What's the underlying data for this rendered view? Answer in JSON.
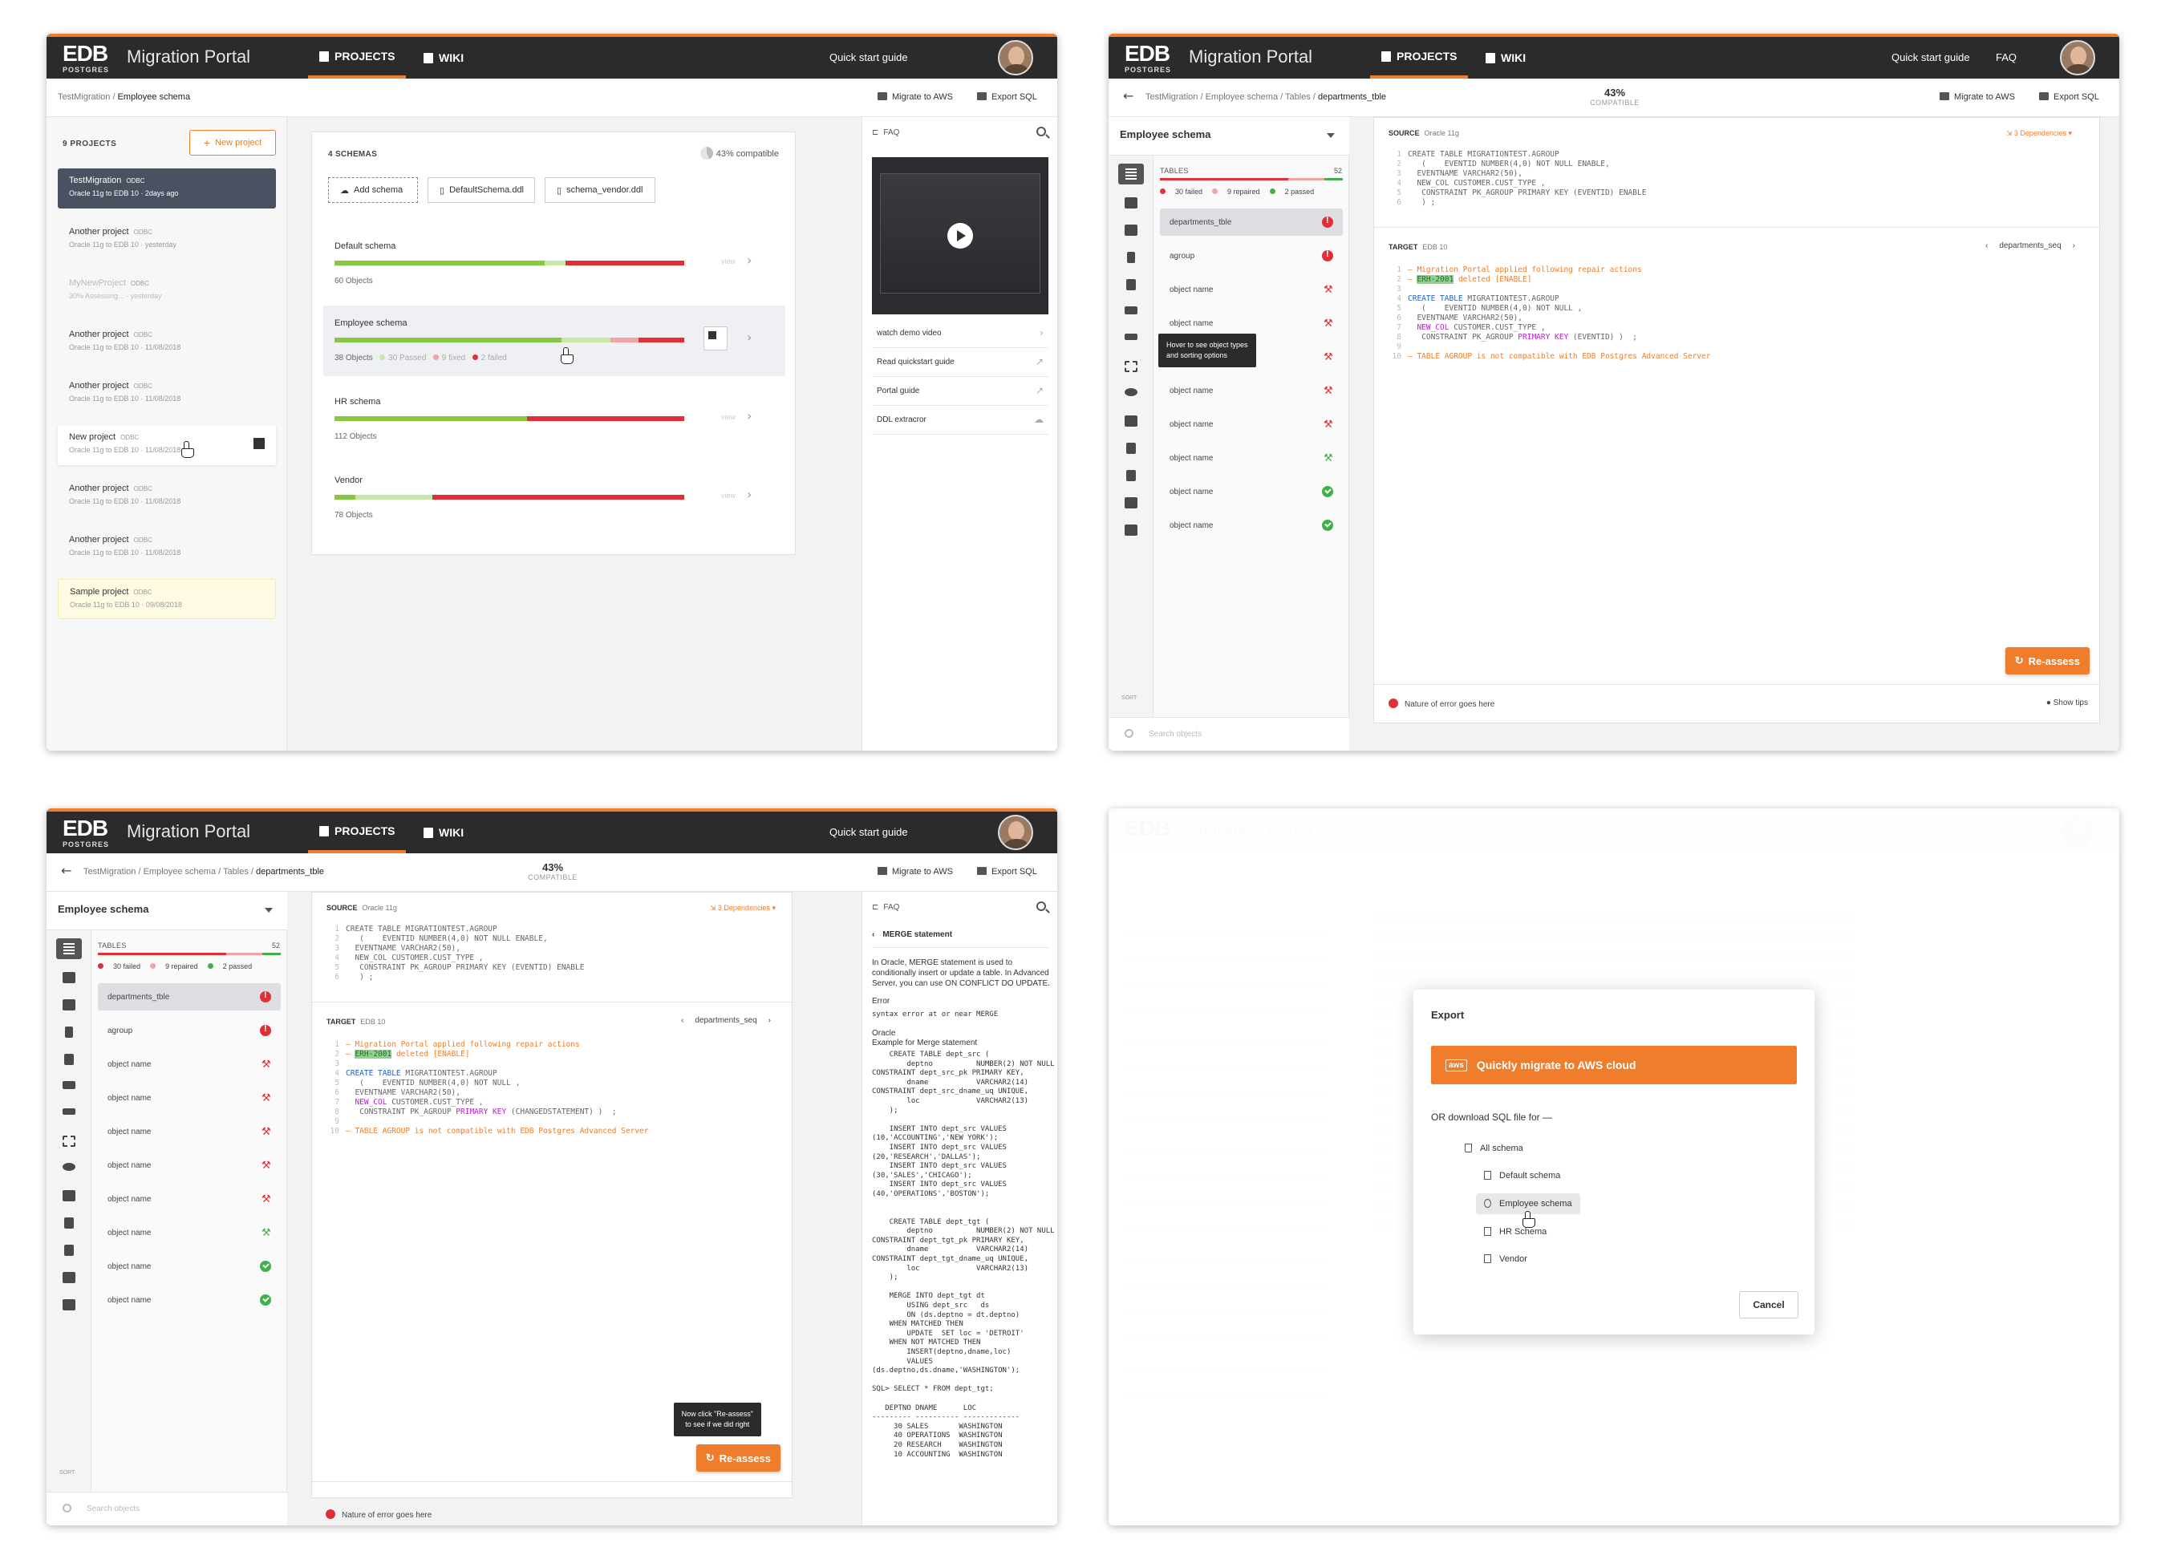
{
  "header": {
    "logo_main": "EDB",
    "logo_sub": "POSTGRES",
    "app_title": "Migration Portal",
    "nav_projects": "PROJECTS",
    "nav_wiki": "WIKI",
    "quick_start": "Quick start guide",
    "faq": "FAQ"
  },
  "toolbar": {
    "migrate_aws": "Migrate to AWS",
    "export_sql": "Export SQL",
    "compat_value": "43%",
    "compat_label": "COMPATIBLE"
  },
  "screen1": {
    "crumb_root": "TestMigration / ",
    "crumb_current": "Employee schema",
    "projects_count": "9 PROJECTS",
    "new_project": "New project",
    "projects": [
      {
        "name": "TestMigration",
        "tag": "ODBC",
        "sub": "Oracle 11g to EDB 10  ·  2days ago"
      },
      {
        "name": "Another project",
        "tag": "ODBC",
        "sub": "Oracle 11g to EDB 10  ·  yesterday"
      },
      {
        "name": "MyNewProject",
        "tag": "ODBC",
        "sub": "30% Assessing...  ·  yesterday"
      },
      {
        "name": "Another project",
        "tag": "ODBC",
        "sub": "Oracle 11g to EDB 10  ·  11/08/2018"
      },
      {
        "name": "Another project",
        "tag": "ODBC",
        "sub": "Oracle 11g to EDB 10  ·  11/08/2018"
      },
      {
        "name": "New project",
        "tag": "ODBC",
        "sub": "Oracle 11g to EDB 10  ·  11/08/2018"
      },
      {
        "name": "Another project",
        "tag": "ODBC",
        "sub": "Oracle 11g to EDB 10  ·  11/08/2018"
      },
      {
        "name": "Another project",
        "tag": "ODBC",
        "sub": "Oracle 11g to EDB 10  ·  11/08/2018"
      },
      {
        "name": "Sample project",
        "tag": "ODBC",
        "sub": "Oracle 11g to EDB 10  ·  09/08/2018"
      }
    ],
    "schemas_count": "4 SCHEMAS",
    "schemas_compat": "43% compatible",
    "add_schema": "Add schema",
    "file1": "DefaultSchema.ddl",
    "file2": "schema_vendor.ddl",
    "schemas": [
      {
        "name": "Default schema",
        "objects": "60  Objects",
        "green": 0.6,
        "light": 0.06,
        "red": 0.34
      },
      {
        "name": "Employee schema",
        "objects": "38  Objects",
        "passed": "30 Passed",
        "repaired": "9 fixed",
        "failed": "2 failed",
        "green": 0.65,
        "light": 0.14,
        "pink": 0.08,
        "red": 0.13
      },
      {
        "name": "HR schema",
        "objects": "112  Objects",
        "green": 0.55,
        "light": 0.0,
        "red": 0.45
      },
      {
        "name": "Vendor",
        "objects": "78  Objects",
        "green": 0.06,
        "light": 0.22,
        "red": 0.72
      }
    ],
    "view": "view",
    "faq_title": "FAQ",
    "faq_links": [
      "watch demo video",
      "Read quickstart guide",
      "Portal guide",
      "DDL extracror"
    ]
  },
  "detail": {
    "crumb_root": "TestMigration / Employee schema / Tables / ",
    "crumb_current": "departments_tble",
    "schema_select": "Employee schema",
    "tables_label": "TABLES",
    "tables_count": "52",
    "failed": "30 failed",
    "repaired": "9 repaired",
    "passed": "2 passed",
    "rows": [
      {
        "name": "departments_tble",
        "status": "fail"
      },
      {
        "name": "agroup",
        "status": "fail"
      },
      {
        "name": "object name",
        "status": "rep"
      },
      {
        "name": "object name",
        "status": "rep"
      },
      {
        "name": "object name",
        "status": "rep"
      },
      {
        "name": "object name",
        "status": "rep"
      },
      {
        "name": "object name",
        "status": "rep"
      },
      {
        "name": "object name",
        "status": "repg"
      },
      {
        "name": "object name",
        "status": "ok"
      },
      {
        "name": "object name",
        "status": "ok"
      }
    ],
    "search_placeholder": "Search objects",
    "sort": "SORT",
    "source_label": "SOURCE",
    "source_db": "Oracle 11g",
    "dependencies": "3 Dependencies",
    "source_code": [
      "CREATE TABLE MIGRATIONTEST.AGROUP",
      "   (    EVENTID NUMBER(4,0) NOT NULL ENABLE,",
      "  EVENTNAME VARCHAR2(50),",
      "  NEW_COL CUSTOMER.CUST_TYPE ,",
      "   CONSTRAINT PK_AGROUP PRIMARY KEY (EVENTID) ENABLE",
      "   ) ;"
    ],
    "target_label": "TARGET",
    "target_db": "EDB 10",
    "seq": "departments_seq",
    "target_c1": "— Migration Portal applied following repair actions",
    "target_c2a": "— ",
    "target_c2b": "ERH-2001",
    "target_c2c": " deleted [ENABLE]",
    "target_code_head": "CREATE TABLE",
    "target_code_tbl": " MIGRATIONTEST.AGROUP",
    "target_l4": "   (    EVENTID NUMBER(4,0) NOT NULL ,",
    "target_l5": "  EVENTNAME VARCHAR2(50),",
    "target_l6a": "  NEW_COL",
    "target_l6b": " CUSTOMER.CUST_TYPE ,",
    "target_l7a": "   CONSTRAINT PK_AGROUP ",
    "target_l7b": "PRIMARY KEY",
    "target_l7c_p2": " (EVENTID) )  ;",
    "target_l7c_p3": " (CHANGEDSTATEMENT) )  ;",
    "target_err": "— TABLE AGROUP is not compatible with EDB Postgres Advanced Server",
    "reassess": "Re-assess",
    "error_text": "Nature of error goes here",
    "show_tips": "Show tips",
    "tooltip_hover_1": "Hover to see object types",
    "tooltip_hover_2": "and sorting options",
    "tooltip_re_1": "Now click \"Re-assess\"",
    "tooltip_re_2": "to see if we did right"
  },
  "faq3": {
    "title": "FAQ",
    "topic": "MERGE statement",
    "intro": "In Oracle, MERGE statement is used to conditionally insert or update a table. In Advanced Server, you can use ON CONFLICT DO UPDATE.",
    "error_label": "Error",
    "error_text": "syntax error at or near MERGE",
    "oracle_label": "Oracle",
    "example_label": "Example for Merge statement",
    "code": [
      "    CREATE TABLE dept_src (",
      "        deptno          NUMBER(2) NOT NULL",
      "CONSTRAINT dept_src_pk PRIMARY KEY,",
      "        dname           VARCHAR2(14)",
      "CONSTRAINT dept_src_dname_uq UNIQUE,",
      "        loc             VARCHAR2(13)",
      "    );",
      "",
      "    INSERT INTO dept_src VALUES",
      "(10,'ACCOUNTING','NEW YORK');",
      "    INSERT INTO dept_src VALUES",
      "(20,'RESEARCH','DALLAS');",
      "    INSERT INTO dept_src VALUES",
      "(30,'SALES','CHICAGO');",
      "    INSERT INTO dept_src VALUES",
      "(40,'OPERATIONS','BOSTON');",
      "",
      "",
      "    CREATE TABLE dept_tgt (",
      "        deptno          NUMBER(2) NOT NULL",
      "CONSTRAINT dept_tgt_pk PRIMARY KEY,",
      "        dname           VARCHAR2(14)",
      "CONSTRAINT dept_tgt_dname_uq UNIQUE,",
      "        loc             VARCHAR2(13)",
      "    );",
      "",
      "    MERGE INTO dept_tgt dt",
      "        USING dept_src   ds",
      "        ON (ds.deptno = dt.deptno)",
      "    WHEN MATCHED THEN",
      "        UPDATE  SET loc = 'DETROIT'",
      "    WHEN NOT MATCHED THEN",
      "        INSERT(deptno,dname,loc)",
      "        VALUES",
      "(ds.deptno,ds.dname,'WASHINGTON');",
      "",
      "SQL> SELECT * FROM dept_tgt;",
      "",
      "   DEPTNO DNAME      LOC",
      "--------- ---------- -------------",
      "     30 SALES       WASHINGTON",
      "     40 OPERATIONS  WASHINGTON",
      "     20 RESEARCH    WASHINGTON",
      "     10 ACCOUNTING  WASHINGTON"
    ]
  },
  "export_modal": {
    "title": "Export",
    "aws_badge": "aws",
    "aws_button": "Quickly migrate to AWS cloud",
    "or_text": "OR download SQL file for —",
    "all_schema": "All schema",
    "items": [
      "Default schema",
      "Employee schema",
      "HR Schema",
      "Vendor"
    ],
    "cancel": "Cancel"
  },
  "colors": {
    "accent": "#ef7d2b",
    "fail": "#e02f36",
    "pass": "#40b04a",
    "pass_light": "#c8e6a8",
    "header": "#2b2b2b"
  }
}
